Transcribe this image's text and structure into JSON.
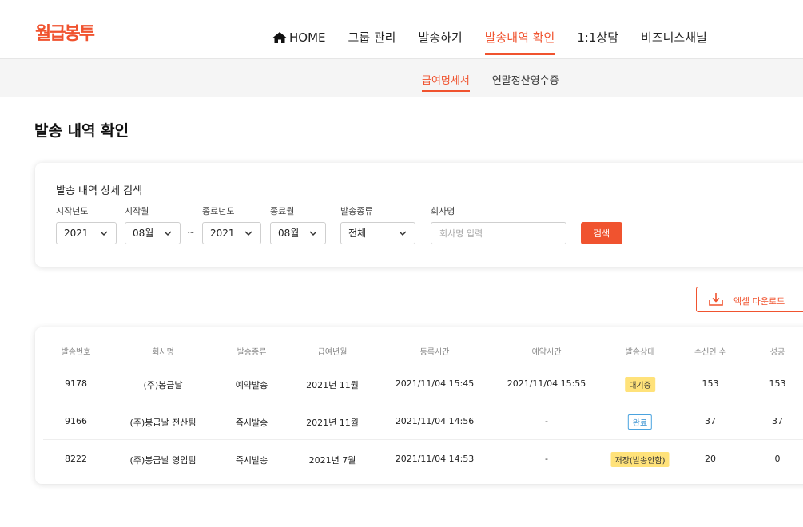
{
  "header": {
    "logo": "월급봉투",
    "nav": [
      {
        "label": "HOME",
        "icon": "home-icon"
      },
      {
        "label": "그룹 관리"
      },
      {
        "label": "발송하기"
      },
      {
        "label": "발송내역 확인",
        "active": true
      },
      {
        "label": "1:1상담"
      },
      {
        "label": "비즈니스채널"
      }
    ]
  },
  "subnav": [
    {
      "label": "급여명세서",
      "active": true
    },
    {
      "label": "연말정산영수증"
    }
  ],
  "page": {
    "title": "발송 내역 확인"
  },
  "search": {
    "title": "발송 내역 상세 검색",
    "labels": {
      "start_year": "시작년도",
      "start_month": "시작월",
      "end_year": "종료년도",
      "end_month": "종료월",
      "send_type": "발송종류",
      "company": "회사명"
    },
    "values": {
      "start_year": "2021",
      "start_month": "08월",
      "end_year": "2021",
      "end_month": "08월",
      "send_type": "전체"
    },
    "tilde": "~",
    "company_placeholder": "회사명 입력",
    "button": "검색"
  },
  "excel": {
    "label": "엑셀 다운로드",
    "icon": "download-icon"
  },
  "table": {
    "headers": [
      "발송번호",
      "회사명",
      "발송종류",
      "급여년월",
      "등록시간",
      "예약시간",
      "발송상태",
      "수신인 수",
      "성공"
    ],
    "rows": [
      {
        "id": "9178",
        "company": "(주)봉급날",
        "type": "예약발송",
        "period": "2021년 11월",
        "registered": "2021/11/04 15:45",
        "reserved": "2021/11/04 15:55",
        "status": "대기중",
        "status_style": "waiting",
        "recipients": "153",
        "success": "153"
      },
      {
        "id": "9166",
        "company": "(주)봉급날 전산팀",
        "type": "즉시발송",
        "period": "2021년 11월",
        "registered": "2021/11/04 14:56",
        "reserved": "-",
        "status": "완료",
        "status_style": "done",
        "recipients": "37",
        "success": "37"
      },
      {
        "id": "8222",
        "company": "(주)봉급날 영업팀",
        "type": "즉시발송",
        "period": "2021년 7월",
        "registered": "2021/11/04 14:53",
        "reserved": "-",
        "status": "저장(발송안함)",
        "status_style": "saved",
        "recipients": "20",
        "success": "0"
      }
    ]
  },
  "colors": {
    "accent": "#f0532f",
    "badge_yellow": "#ffe27a",
    "badge_blue": "#4aa3df"
  }
}
